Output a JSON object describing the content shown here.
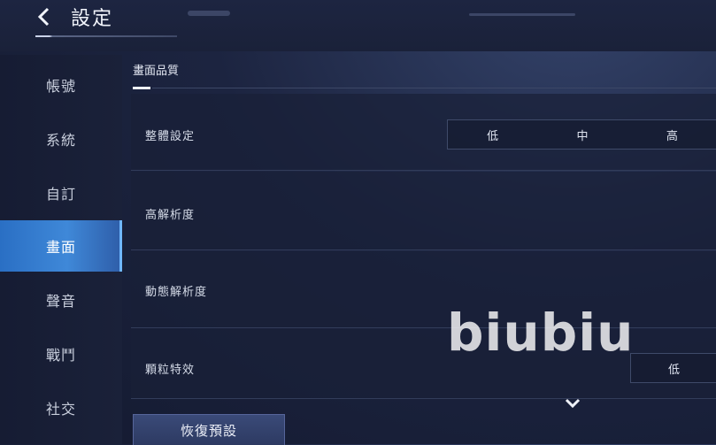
{
  "header": {
    "title": "設定",
    "back_icon": "chevron-left-icon"
  },
  "sidebar": {
    "items": [
      {
        "label": "帳號",
        "active": false
      },
      {
        "label": "系統",
        "active": false
      },
      {
        "label": "自訂",
        "active": false
      },
      {
        "label": "畫面",
        "active": true
      },
      {
        "label": "聲音",
        "active": false
      },
      {
        "label": "戰鬥",
        "active": false
      },
      {
        "label": "社交",
        "active": false
      }
    ]
  },
  "main": {
    "section_tab": "畫面品質",
    "settings": [
      {
        "label": "整體設定",
        "options": [
          "低",
          "中",
          "高"
        ]
      },
      {
        "label": "高解析度"
      },
      {
        "label": "動態解析度"
      },
      {
        "label": "顆粒特效",
        "options": [
          "低"
        ]
      }
    ],
    "restore_button": "恢復預設",
    "scroll_icon": "chevron-down-icon"
  },
  "watermark": "biubiu",
  "colors": {
    "active_tab": "#3f88d8",
    "background": "#1c2440"
  }
}
